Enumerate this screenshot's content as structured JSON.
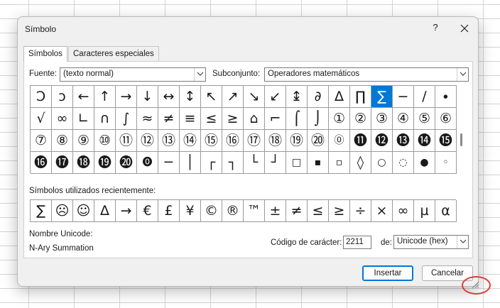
{
  "dialog": {
    "title": "Símbolo",
    "help_label": "?"
  },
  "tabs": [
    {
      "label": "Símbolos",
      "active": true
    },
    {
      "label": "Caracteres especiales",
      "active": false
    }
  ],
  "font": {
    "label": "Fuente:",
    "value": "(texto normal)"
  },
  "subset": {
    "label": "Subconjunto:",
    "value": "Operadores matemáticos"
  },
  "symbols": [
    "Ↄ",
    "ↄ",
    "←",
    "↑",
    "→",
    "↓",
    "↔",
    "↕",
    "↖",
    "↗",
    "↘",
    "↙",
    "↨",
    "∂",
    "∆",
    "∏",
    "∑",
    "−",
    "∕",
    "∙",
    "√",
    "∞",
    "∟",
    "∩",
    "∫",
    "≈",
    "≠",
    "≡",
    "≤",
    "≥",
    "⌂",
    "⌐",
    "⌠",
    "⌡",
    "①",
    "②",
    "③",
    "④",
    "⑤",
    "⑥",
    "⑦",
    "⑧",
    "⑨",
    "⑩",
    "⑪",
    "⑫",
    "⑬",
    "⑭",
    "⑮",
    "⑯",
    "⑰",
    "⑱",
    "⑲",
    "⑳",
    "⓪",
    "⓫",
    "⓬",
    "⓭",
    "⓮",
    "⓯",
    "⓰",
    "⓱",
    "⓲",
    "⓳",
    "⓴",
    "⓿",
    "─",
    "│",
    "┌",
    "┐",
    "└",
    "┘",
    "□",
    "▪",
    "▫",
    "◊",
    "○",
    "◌",
    "●",
    "◦"
  ],
  "selected_symbol_index": 16,
  "recent": {
    "label": "Símbolos utilizados recientemente:",
    "items": [
      "∑",
      "☹",
      "☺",
      "∆",
      "→",
      "€",
      "£",
      "¥",
      "©",
      "®",
      "™",
      "±",
      "≠",
      "≤",
      "≥",
      "÷",
      "×",
      "∞",
      "µ",
      "α"
    ]
  },
  "unicode_name": {
    "label": "Nombre Unicode:",
    "value": "N-Ary Summation"
  },
  "char_code": {
    "label": "Código de carácter:",
    "value": "2211"
  },
  "from": {
    "label": "de:",
    "value": "Unicode (hex)"
  },
  "buttons": {
    "insert": "Insertar",
    "cancel": "Cancelar"
  },
  "colors": {
    "selection": "#0078d7",
    "highlight_ring": "#e03c3c"
  }
}
